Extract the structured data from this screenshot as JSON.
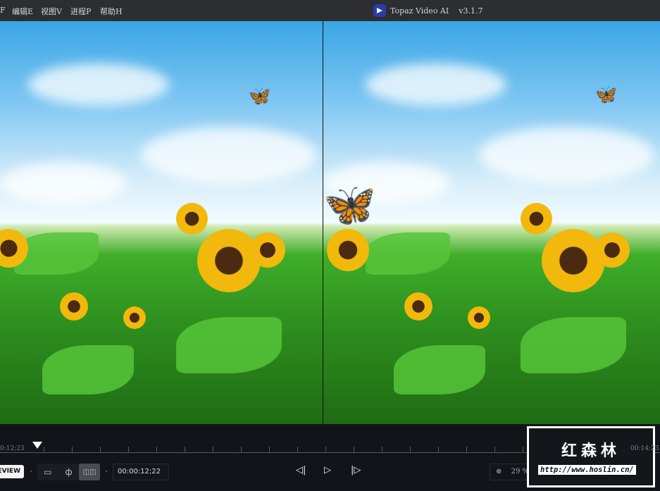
{
  "menu": [
    {
      "label": "F"
    },
    {
      "label": "编辑E"
    },
    {
      "label": "视图V"
    },
    {
      "label": "进程P"
    },
    {
      "label": "帮助H"
    }
  ],
  "app": {
    "title": "Topaz Video AI",
    "version": "v3.1.7"
  },
  "timeline": {
    "current_label": "0:12;23",
    "end_label": "00:14:23",
    "playhead_fraction": 0.0
  },
  "controls": {
    "preview_label": "EVIEW",
    "timecode": "00:00:12;22",
    "view_modes": [
      {
        "icon": "single-view-icon",
        "glyph": "▭"
      },
      {
        "icon": "split-view-icon",
        "glyph": "ф"
      },
      {
        "icon": "side-by-side-icon",
        "glyph": "◫◫"
      }
    ],
    "zoom": "29 %",
    "prev_frame": "◁|",
    "play": "▷",
    "next_frame": "|▷"
  },
  "watermark": {
    "title": "红森林",
    "url": "http://www.hoslin.cn/"
  }
}
